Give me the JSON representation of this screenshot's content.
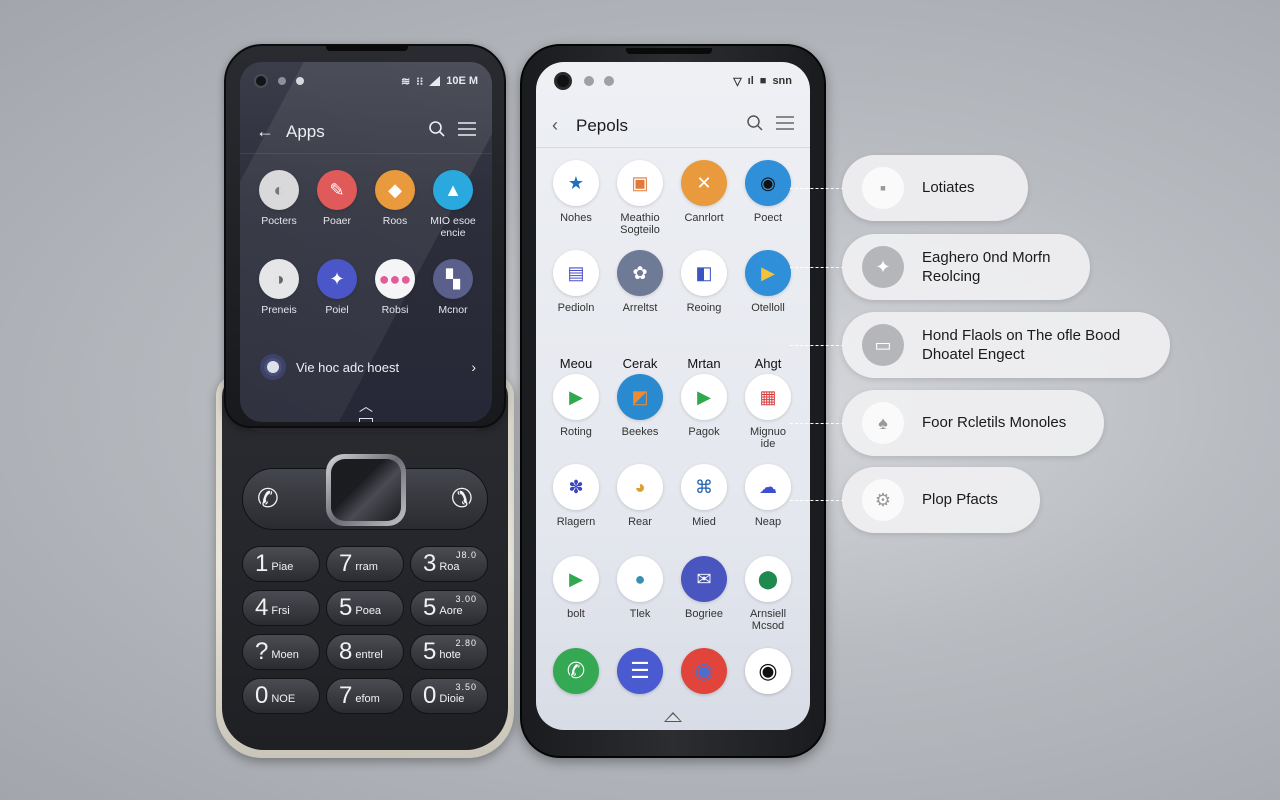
{
  "left_phone": {
    "status": {
      "time": "10E M"
    },
    "header": {
      "back_icon": "arrow-left-icon",
      "title": "Apps",
      "search_icon": "search-icon",
      "menu_icon": "hamburger-menu-icon"
    },
    "apps": [
      {
        "label": "Pocters",
        "color": "#d9d9dc",
        "glyph": "◐",
        "glyph_color": "#777"
      },
      {
        "label": "Poaer",
        "color": "#e05a5a",
        "glyph": "✎",
        "glyph_color": "#fff"
      },
      {
        "label": "Roos",
        "color": "#e89a3c",
        "glyph": "◆",
        "glyph_color": "#fff"
      },
      {
        "label": "MIO esoe\nencie",
        "color": "#29a9de",
        "glyph": "▲",
        "glyph_color": "#fff"
      },
      {
        "label": "Preneis",
        "color": "#e6e6e8",
        "glyph": "◑",
        "glyph_color": "#666"
      },
      {
        "label": "Poiel",
        "color": "#4b56c8",
        "glyph": "✦",
        "glyph_color": "#fff"
      },
      {
        "label": "Robsi",
        "color": "#f5f5f7",
        "glyph": "●●●",
        "glyph_color": "#e45b9a"
      },
      {
        "label": "Mcnor",
        "color": "#5a5f8c",
        "glyph": "▚",
        "glyph_color": "#fff"
      }
    ],
    "suggestion": {
      "text": "Vie hoc adc hoest",
      "chevron_icon": "chevron-right-icon"
    },
    "nav": {
      "up_icon": "chevron-up-icon",
      "home_icon": "home-square-icon"
    },
    "call_keys": {
      "answer_icon": "phone-answer-icon",
      "hangup_icon": "phone-hangup-icon",
      "dpad_icon": "dpad-center-button"
    },
    "keys": [
      {
        "num": "1",
        "sub": "Piae",
        "sup": ""
      },
      {
        "num": "7",
        "sub": "rram",
        "sup": ""
      },
      {
        "num": "3",
        "sub": "Roa",
        "sup": "J8.0"
      },
      {
        "num": "4",
        "sub": "Frsi",
        "sup": ""
      },
      {
        "num": "5",
        "sub": "Poea",
        "sup": ""
      },
      {
        "num": "5",
        "sub": "Aore",
        "sup": "3.00"
      },
      {
        "num": "?",
        "sub": "Moen",
        "sup": ""
      },
      {
        "num": "8",
        "sub": "entrel",
        "sup": ""
      },
      {
        "num": "5",
        "sub": "hote",
        "sup": "2.80"
      },
      {
        "num": "0",
        "sub": "NOE",
        "sup": ""
      },
      {
        "num": "7",
        "sub": "efom",
        "sup": ""
      },
      {
        "num": "0",
        "sub": "Dioie",
        "sup": "3.50"
      }
    ]
  },
  "right_phone": {
    "status": {
      "time": "snn"
    },
    "header": {
      "back_icon": "chevron-left-icon",
      "title": "Pepols",
      "search_icon": "search-icon",
      "menu_icon": "hamburger-menu-icon"
    },
    "row1": [
      {
        "label": "Nohes",
        "color": "#ffffff",
        "glyph": "★",
        "glyph_color": "#1f6fc2"
      },
      {
        "label": "Meathio\nSogteilo",
        "color": "#ffffff",
        "glyph": "▣",
        "glyph_color": "#e07a3a"
      },
      {
        "label": "Canrlort",
        "color": "#e89a3c",
        "glyph": "✕",
        "glyph_color": "#fff"
      },
      {
        "label": "Poect",
        "color": "#2f8fd8",
        "glyph": "◉",
        "glyph_color": "#111"
      }
    ],
    "row2": [
      {
        "label": "Pedioln",
        "color": "#ffffff",
        "glyph": "▤",
        "glyph_color": "#4a4fc8"
      },
      {
        "label": "Arreltst",
        "color": "#6e7a96",
        "glyph": "✿",
        "glyph_color": "#fff"
      },
      {
        "label": "Reoing",
        "color": "#ffffff",
        "glyph": "◧",
        "glyph_color": "#3a55c0"
      },
      {
        "label": "Otelloll",
        "color": "#2f8fd8",
        "glyph": "▶",
        "glyph_color": "#f2c23a"
      }
    ],
    "section_labels": [
      "Meou",
      "Cerak",
      "Mrtan",
      "Ahgt"
    ],
    "row3": [
      {
        "label": "Roting",
        "color": "#ffffff",
        "glyph": "▶",
        "glyph_color": "#2fa84f"
      },
      {
        "label": "Beekes",
        "color": "#2a8ad0",
        "glyph": "◩",
        "glyph_color": "#f08a30"
      },
      {
        "label": "Pagok",
        "color": "#ffffff",
        "glyph": "▶",
        "glyph_color": "#2fa84f"
      },
      {
        "label": "Mignuo\nide",
        "color": "#ffffff",
        "glyph": "▦",
        "glyph_color": "#d94040"
      }
    ],
    "row4": [
      {
        "label": "Rlagern",
        "color": "#ffffff",
        "glyph": "✽",
        "glyph_color": "#3d46c0"
      },
      {
        "label": "Rear",
        "color": "#ffffff",
        "glyph": "◕",
        "glyph_color": "#d9a030"
      },
      {
        "label": "Mied",
        "color": "#ffffff",
        "glyph": "⌘",
        "glyph_color": "#1f5fb0"
      },
      {
        "label": "Neap",
        "color": "#ffffff",
        "glyph": "☁",
        "glyph_color": "#3d4ed0"
      }
    ],
    "row5": [
      {
        "label": "bolt",
        "color": "#ffffff",
        "glyph": "▶",
        "glyph_color": "#2fa84f"
      },
      {
        "label": "Tlek",
        "color": "#ffffff",
        "glyph": "●",
        "glyph_color": "#3a8fb0"
      },
      {
        "label": "Bogriee",
        "color": "#4a56c0",
        "glyph": "✉",
        "glyph_color": "#fff"
      },
      {
        "label": "Arnsiell\nMcsod",
        "color": "#ffffff",
        "glyph": "⬤",
        "glyph_color": "#1f8a50"
      }
    ],
    "dock": [
      {
        "name": "phone-app",
        "color": "#35a853",
        "glyph": "✆",
        "glyph_color": "#fff"
      },
      {
        "name": "messages-app",
        "color": "#4a5ad0",
        "glyph": "☰",
        "glyph_color": "#fff"
      },
      {
        "name": "chrome-app",
        "color": "#e0443a",
        "glyph": "◉",
        "glyph_color": "#4a6fd0"
      },
      {
        "name": "camera-app",
        "color": "#ffffff",
        "glyph": "◉",
        "glyph_color": "#111"
      }
    ],
    "nav": {
      "up_icon": "chevron-up-icon"
    }
  },
  "callouts": [
    {
      "text": "Lotiates",
      "icon": "square-icon",
      "glyph": "▪",
      "grey": false
    },
    {
      "text": "Eaghero 0nd Morfn\nReolcing",
      "icon": "badge-icon",
      "glyph": "✦",
      "grey": true
    },
    {
      "text": "Hond Flaols on The ofle Bood\nDhoatel Engect",
      "icon": "window-icon",
      "glyph": "▭",
      "grey": true
    },
    {
      "text": "Foor Rcletils Monoles",
      "icon": "shovel-icon",
      "glyph": "♠",
      "grey": false
    },
    {
      "text": "Plop Pfacts",
      "icon": "gear-icon",
      "glyph": "⚙",
      "grey": false
    }
  ]
}
